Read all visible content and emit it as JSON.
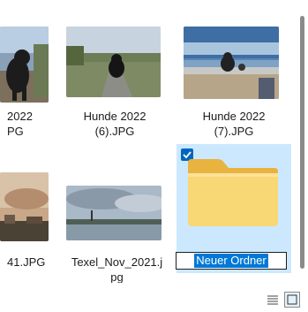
{
  "items": [
    {
      "label_line1": "2022",
      "label_line2": "PG",
      "kind": "image"
    },
    {
      "label_line1": "Hunde 2022",
      "label_line2": "(6).JPG",
      "kind": "image"
    },
    {
      "label_line1": "Hunde 2022",
      "label_line2": "(7).JPG",
      "kind": "image"
    },
    {
      "label_line1": "41.JPG",
      "label_line2": "",
      "kind": "image"
    },
    {
      "label_line1": "Texel_Nov_2021.j",
      "label_line2": "pg",
      "kind": "image"
    },
    {
      "label_line1": "Neuer Ordner",
      "label_line2": "",
      "kind": "folder",
      "selected": true,
      "renaming": true
    }
  ],
  "rename": {
    "value": "Neuer Ordner"
  },
  "statusbar": {
    "list_view_icon": "details-view-icon",
    "tiles_view_icon": "large-icons-view-icon"
  },
  "colors": {
    "selection": "#cce8ff",
    "accent": "#0067c0",
    "text_highlight": "#0078d7",
    "folder_body": "#f8d775",
    "folder_tab": "#e8b33f"
  }
}
